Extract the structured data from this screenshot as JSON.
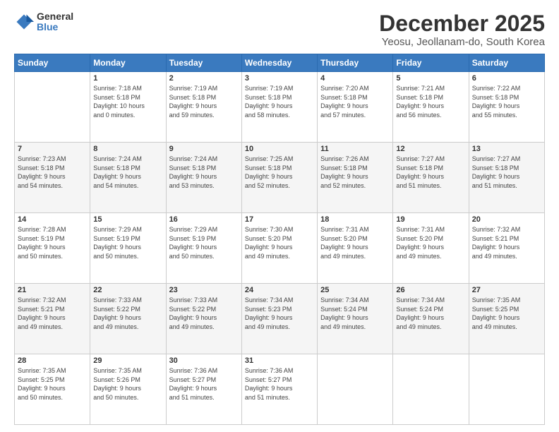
{
  "logo": {
    "general": "General",
    "blue": "Blue"
  },
  "title": {
    "month": "December 2025",
    "location": "Yeosu, Jeollanam-do, South Korea"
  },
  "weekdays": [
    "Sunday",
    "Monday",
    "Tuesday",
    "Wednesday",
    "Thursday",
    "Friday",
    "Saturday"
  ],
  "weeks": [
    [
      {
        "day": "",
        "info": ""
      },
      {
        "day": "1",
        "info": "Sunrise: 7:18 AM\nSunset: 5:18 PM\nDaylight: 10 hours\nand 0 minutes."
      },
      {
        "day": "2",
        "info": "Sunrise: 7:19 AM\nSunset: 5:18 PM\nDaylight: 9 hours\nand 59 minutes."
      },
      {
        "day": "3",
        "info": "Sunrise: 7:19 AM\nSunset: 5:18 PM\nDaylight: 9 hours\nand 58 minutes."
      },
      {
        "day": "4",
        "info": "Sunrise: 7:20 AM\nSunset: 5:18 PM\nDaylight: 9 hours\nand 57 minutes."
      },
      {
        "day": "5",
        "info": "Sunrise: 7:21 AM\nSunset: 5:18 PM\nDaylight: 9 hours\nand 56 minutes."
      },
      {
        "day": "6",
        "info": "Sunrise: 7:22 AM\nSunset: 5:18 PM\nDaylight: 9 hours\nand 55 minutes."
      }
    ],
    [
      {
        "day": "7",
        "info": "Sunrise: 7:23 AM\nSunset: 5:18 PM\nDaylight: 9 hours\nand 54 minutes."
      },
      {
        "day": "8",
        "info": "Sunrise: 7:24 AM\nSunset: 5:18 PM\nDaylight: 9 hours\nand 54 minutes."
      },
      {
        "day": "9",
        "info": "Sunrise: 7:24 AM\nSunset: 5:18 PM\nDaylight: 9 hours\nand 53 minutes."
      },
      {
        "day": "10",
        "info": "Sunrise: 7:25 AM\nSunset: 5:18 PM\nDaylight: 9 hours\nand 52 minutes."
      },
      {
        "day": "11",
        "info": "Sunrise: 7:26 AM\nSunset: 5:18 PM\nDaylight: 9 hours\nand 52 minutes."
      },
      {
        "day": "12",
        "info": "Sunrise: 7:27 AM\nSunset: 5:18 PM\nDaylight: 9 hours\nand 51 minutes."
      },
      {
        "day": "13",
        "info": "Sunrise: 7:27 AM\nSunset: 5:18 PM\nDaylight: 9 hours\nand 51 minutes."
      }
    ],
    [
      {
        "day": "14",
        "info": "Sunrise: 7:28 AM\nSunset: 5:19 PM\nDaylight: 9 hours\nand 50 minutes."
      },
      {
        "day": "15",
        "info": "Sunrise: 7:29 AM\nSunset: 5:19 PM\nDaylight: 9 hours\nand 50 minutes."
      },
      {
        "day": "16",
        "info": "Sunrise: 7:29 AM\nSunset: 5:19 PM\nDaylight: 9 hours\nand 50 minutes."
      },
      {
        "day": "17",
        "info": "Sunrise: 7:30 AM\nSunset: 5:20 PM\nDaylight: 9 hours\nand 49 minutes."
      },
      {
        "day": "18",
        "info": "Sunrise: 7:31 AM\nSunset: 5:20 PM\nDaylight: 9 hours\nand 49 minutes."
      },
      {
        "day": "19",
        "info": "Sunrise: 7:31 AM\nSunset: 5:20 PM\nDaylight: 9 hours\nand 49 minutes."
      },
      {
        "day": "20",
        "info": "Sunrise: 7:32 AM\nSunset: 5:21 PM\nDaylight: 9 hours\nand 49 minutes."
      }
    ],
    [
      {
        "day": "21",
        "info": "Sunrise: 7:32 AM\nSunset: 5:21 PM\nDaylight: 9 hours\nand 49 minutes."
      },
      {
        "day": "22",
        "info": "Sunrise: 7:33 AM\nSunset: 5:22 PM\nDaylight: 9 hours\nand 49 minutes."
      },
      {
        "day": "23",
        "info": "Sunrise: 7:33 AM\nSunset: 5:22 PM\nDaylight: 9 hours\nand 49 minutes."
      },
      {
        "day": "24",
        "info": "Sunrise: 7:34 AM\nSunset: 5:23 PM\nDaylight: 9 hours\nand 49 minutes."
      },
      {
        "day": "25",
        "info": "Sunrise: 7:34 AM\nSunset: 5:24 PM\nDaylight: 9 hours\nand 49 minutes."
      },
      {
        "day": "26",
        "info": "Sunrise: 7:34 AM\nSunset: 5:24 PM\nDaylight: 9 hours\nand 49 minutes."
      },
      {
        "day": "27",
        "info": "Sunrise: 7:35 AM\nSunset: 5:25 PM\nDaylight: 9 hours\nand 49 minutes."
      }
    ],
    [
      {
        "day": "28",
        "info": "Sunrise: 7:35 AM\nSunset: 5:25 PM\nDaylight: 9 hours\nand 50 minutes."
      },
      {
        "day": "29",
        "info": "Sunrise: 7:35 AM\nSunset: 5:26 PM\nDaylight: 9 hours\nand 50 minutes."
      },
      {
        "day": "30",
        "info": "Sunrise: 7:36 AM\nSunset: 5:27 PM\nDaylight: 9 hours\nand 51 minutes."
      },
      {
        "day": "31",
        "info": "Sunrise: 7:36 AM\nSunset: 5:27 PM\nDaylight: 9 hours\nand 51 minutes."
      },
      {
        "day": "",
        "info": ""
      },
      {
        "day": "",
        "info": ""
      },
      {
        "day": "",
        "info": ""
      }
    ]
  ]
}
